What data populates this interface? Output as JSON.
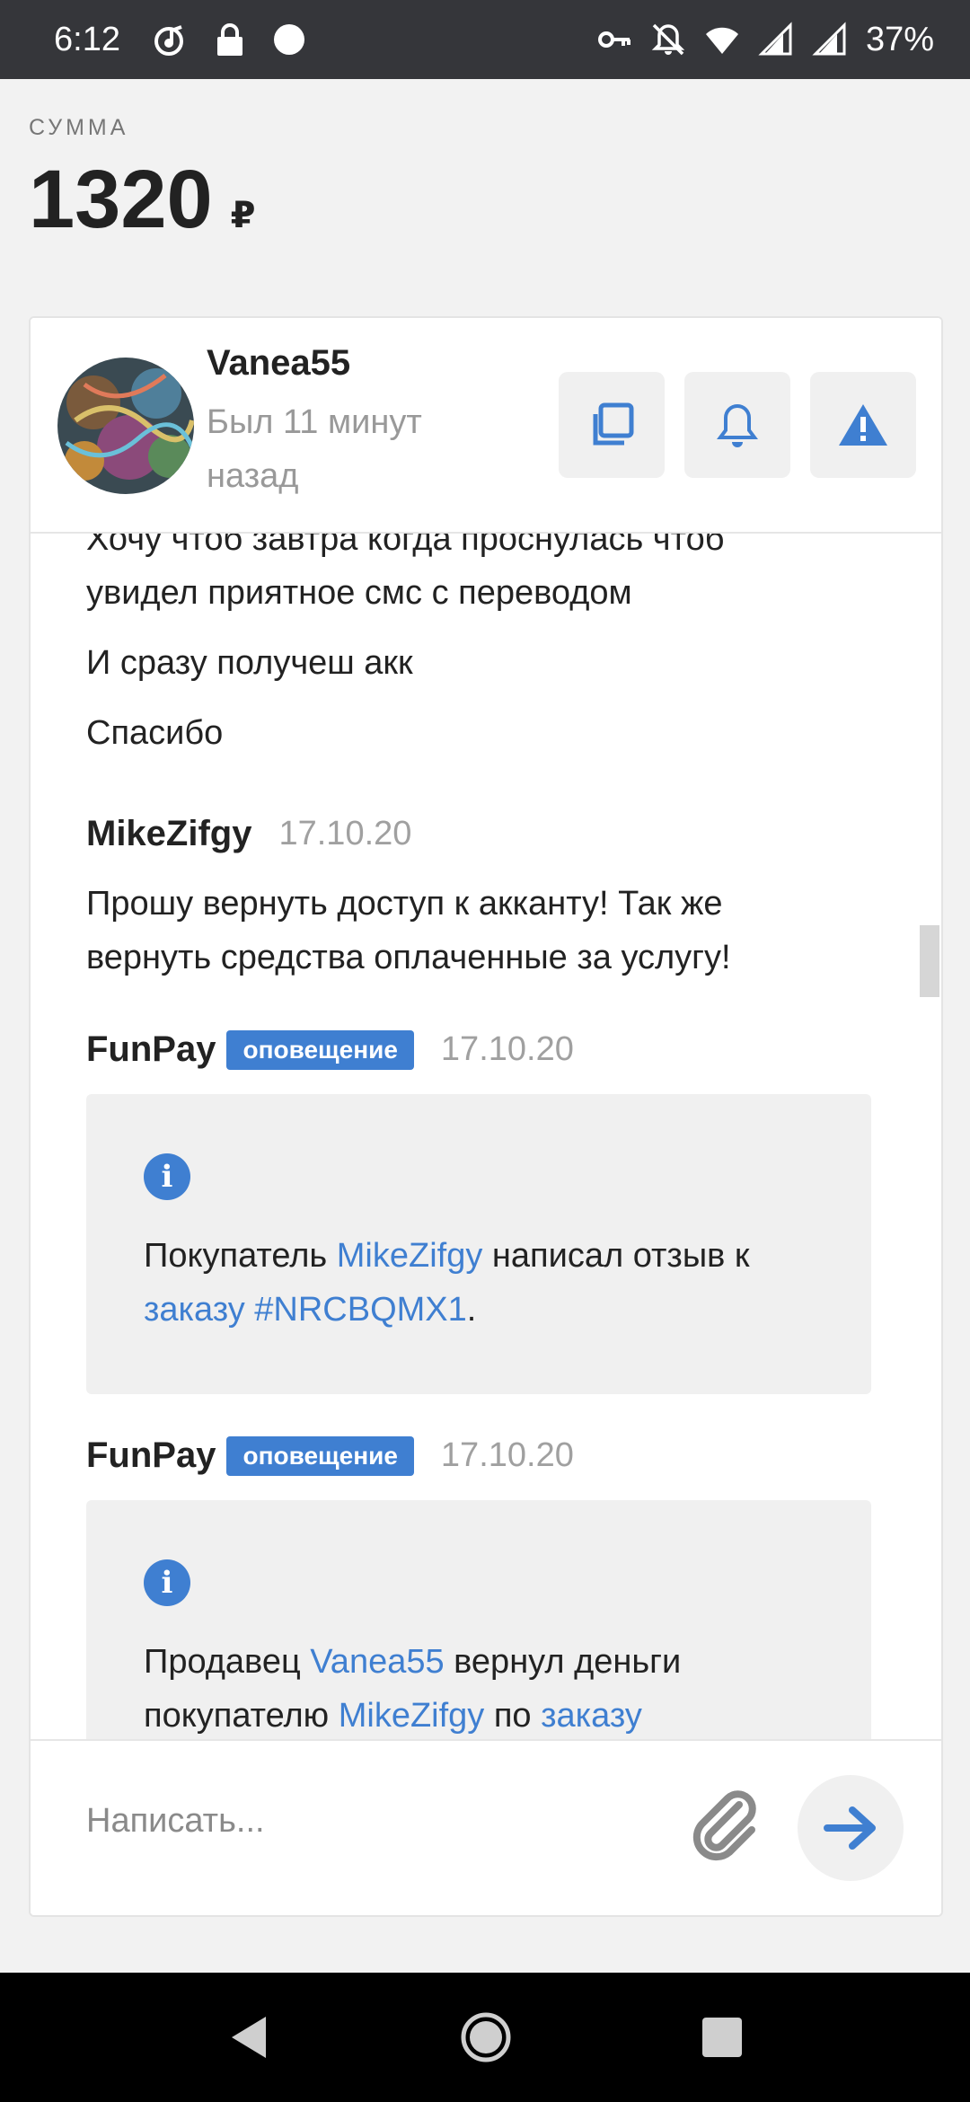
{
  "status_bar": {
    "time": "6:12",
    "battery": "37%"
  },
  "order": {
    "sum_label": "СУММА",
    "sum_value": "1320",
    "currency": "₽"
  },
  "chat": {
    "user_name": "Vanea55",
    "user_status": "Был 11 минут назад",
    "messages": {
      "line1": "Хочу чтоб завтра когда проснулась чтоб",
      "line2": "увидел приятное смс с переводом",
      "line3": "И сразу получеш акк",
      "line4": "Спасибо",
      "m2_author": "MikeZifgy",
      "m2_date": "17.10.20",
      "m2_line1": "Прошу вернуть доступ к акканту! Так же",
      "m2_line2": "вернуть средства оплаченные за услугу!",
      "n1_author": "FunPay",
      "n1_badge": "оповещение",
      "n1_date": "17.10.20",
      "n1_t1": "Покупатель ",
      "n1_link1": "MikeZifgy",
      "n1_t2": " написал отзыв к ",
      "n1_link2": "заказу #NRCBQMX1",
      "n1_t3": ".",
      "n2_author": "FunPay",
      "n2_badge": "оповещение",
      "n2_date": "17.10.20",
      "n2_t1": "Продавец ",
      "n2_link1": "Vanea55",
      "n2_t2": " вернул деньги покупателю ",
      "n2_link2": "MikeZifgy",
      "n2_t3": " по ",
      "n2_link3": "заказу"
    },
    "input_placeholder": "Написать..."
  },
  "colors": {
    "accent": "#3f7fd1",
    "status_bar": "#35363a",
    "nav_bar": "#000000"
  },
  "icons": [
    "copy-icon",
    "bell-icon",
    "alert-icon",
    "info-icon",
    "paperclip-icon",
    "send-arrow-icon",
    "back-icon",
    "home-icon",
    "recents-icon"
  ]
}
